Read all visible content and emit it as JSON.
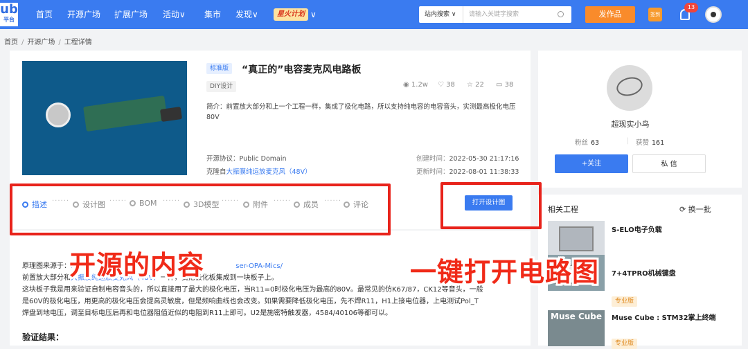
{
  "header": {
    "logo_top": "ub",
    "logo_bottom": "平台",
    "nav": [
      "首页",
      "开源广场",
      "扩展广场",
      "活动",
      "集市",
      "发现"
    ],
    "nav_caret": "∨",
    "fire_plan": "星火计划",
    "search_select": "站内搜索 ∨",
    "search_placeholder": "请输入关键字搜索",
    "publish_label": "发作品",
    "calendar_label": "签到",
    "notification_count": "13"
  },
  "breadcrumb": [
    "首页",
    "开源广场",
    "工程详情"
  ],
  "project": {
    "badge": "标准版",
    "title": "“真正的”电容麦克风电路板",
    "category": "DIY设计",
    "views": "1.2w",
    "likes": "38",
    "stars": "22",
    "comments": "38",
    "intro": "简介：前置放大部分和上一个工程一样，集成了极化电路，所以支持纯电容的电容音头，实测最高极化电压80V",
    "license_label": "开源协议：",
    "license": "Public Domain",
    "clone_label": "克隆自",
    "clone_source": "大振膜纯运放麦克风（48V）",
    "created_label": "创建时间：",
    "created": "2022-05-30 21:17:16",
    "updated_label": "更新时间：",
    "updated": "2022-08-01 11:38:33"
  },
  "steps": [
    "描述",
    "设计图",
    "BOM",
    "3D模型",
    "附件",
    "成员",
    "评论"
  ],
  "step_dashes": "······",
  "open_design_label": "打开设计图",
  "description": {
    "heading": "描述",
    "line1_prefix": "原理图来源于：",
    "line1_link_a": "ht",
    "line1_link_b": "ser-OPA-Mics/",
    "line2_prefix": "前置放大部分和",
    "line2_link": "大振膜纯运放麦克风（48V）",
    "line2_suffix": "一样，我把极化板集成到一块板子上。",
    "line3": "这块板子我是用来验证自制电容音头的，所以直接用了最大的极化电压，当R11=0时极化电压为最高的80V。最常见的仿K67/87，CK12等音头，一般",
    "line4": "是60V的极化电压，用更高的极化电压会提高灵敏度，但是频响曲线也会改变。如果需要降低极化电压，先不焊R11，H1上接电位器，上电测试Pol_T",
    "line5": "焊盘到地电压，调至目标电压后再和电位器阻值近似的电阻到R11上即可。U2是施密特触发器，4584/40106等都可以。",
    "verify_heading": "验证结果："
  },
  "overlays": {
    "left": "开源的内容",
    "right": "一键打开电路图"
  },
  "author": {
    "name": "超现实小鸟",
    "fans_label": "粉丝",
    "fans": "63",
    "awards_label": "获赞",
    "awards": "161",
    "follow_label": "+关注",
    "message_label": "私 信"
  },
  "related": {
    "heading": "相关工程",
    "swap_label": "⟳ 换一批",
    "items": [
      {
        "name": "S-ELO电子负载",
        "tag": ""
      },
      {
        "name": "7+4TPRO机械键盘",
        "tag": ""
      },
      {
        "name": "Muse Cube : STM32掌上终端",
        "tag": "专业版"
      }
    ],
    "pro_tag": "专业版",
    "muse_cube_text": "Muse Cube"
  },
  "colors": {
    "primary": "#3a7bf0",
    "accent": "#f98b2b",
    "highlight": "#e8231b"
  }
}
